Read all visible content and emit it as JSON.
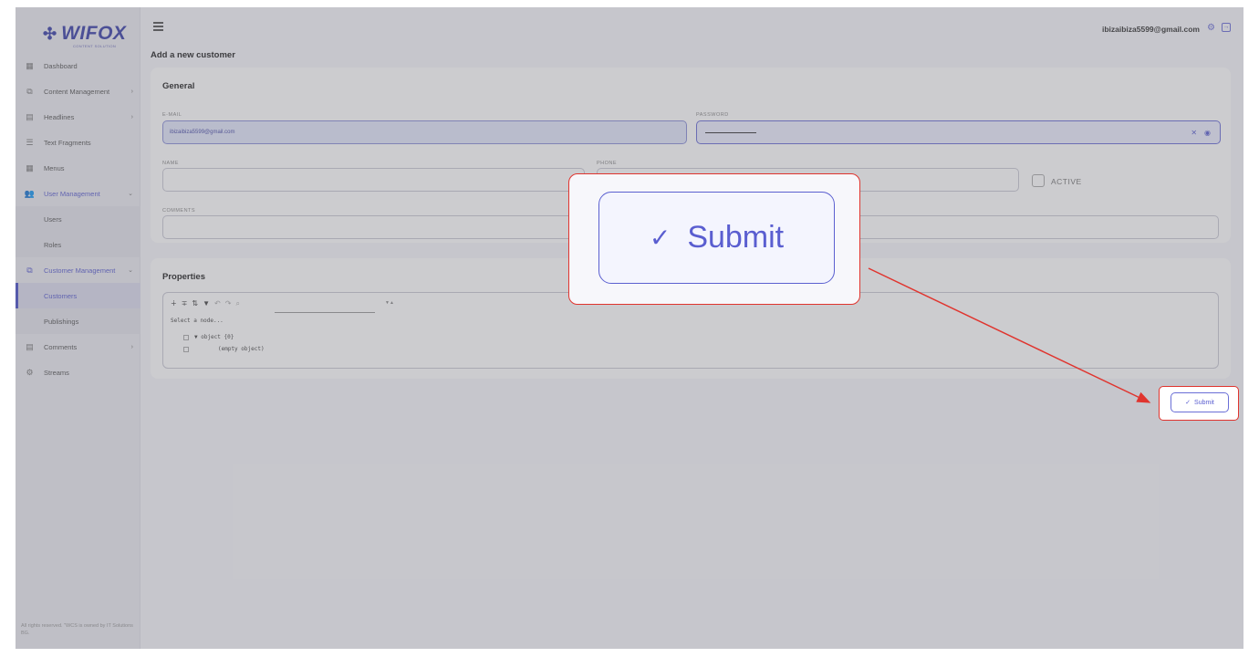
{
  "brand": {
    "logo_text": "WIFOX",
    "logo_subtitle": "CONTENT SOLUTION",
    "logo_mark": "✣"
  },
  "sidebar": {
    "items": [
      {
        "label": "Dashboard",
        "icon": "▦"
      },
      {
        "label": "Content Management",
        "icon": "⧉"
      },
      {
        "label": "Headlines",
        "icon": "▤"
      },
      {
        "label": "Text Fragments",
        "icon": "☰"
      },
      {
        "label": "Menus",
        "icon": "▦"
      },
      {
        "label": "User Management",
        "icon": "👥"
      },
      {
        "label": "Users"
      },
      {
        "label": "Roles"
      },
      {
        "label": "Customer Management",
        "icon": "⧉"
      },
      {
        "label": "Customers"
      },
      {
        "label": "Publishings"
      },
      {
        "label": "Comments",
        "icon": "▤"
      },
      {
        "label": "Streams",
        "icon": "⚙"
      }
    ],
    "chevron_right": "›",
    "chevron_down": "⌄",
    "footer": "All rights reserved. \"WCS is owned by IT Solutions BG."
  },
  "topbar": {
    "user_email": "ibizaibiza5599@gmail.com",
    "gear_icon": "⚙",
    "logout_icon": "→"
  },
  "page_title": "Add a new customer",
  "general": {
    "title": "General",
    "email_label": "E-MAIL",
    "email_value": "ibizaibiza5599@gmail.com",
    "password_label": "PASSWORD",
    "clear_icon": "✕",
    "eye_icon": "◉",
    "name_label": "NAME",
    "phone_label": "PHONE",
    "active_label": "ACTIVE",
    "comments_label": "COMMENTS"
  },
  "properties": {
    "title": "Properties",
    "tools": [
      "∔",
      "∓",
      "⇅",
      "▼",
      "↶",
      "↷",
      "⌕"
    ],
    "caret": "▼▲",
    "hint": "Select a node...",
    "row1": "▼ object {0}",
    "row2": "(empty object)"
  },
  "submit": {
    "label": "Submit",
    "check": "✓"
  },
  "colors": {
    "accent": "#5a5ed0",
    "highlight": "#e0342e"
  }
}
